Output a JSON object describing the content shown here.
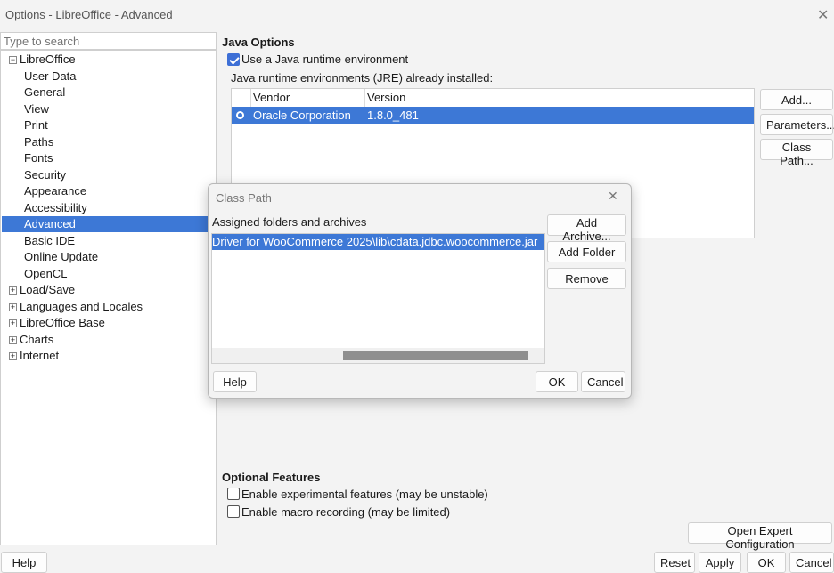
{
  "window": {
    "title": "Options - LibreOffice - Advanced"
  },
  "search": {
    "placeholder": "Type to search"
  },
  "tree": {
    "root_libreoffice": "LibreOffice",
    "libreoffice_children": [
      "User Data",
      "General",
      "View",
      "Print",
      "Paths",
      "Fonts",
      "Security",
      "Appearance",
      "Accessibility",
      "Advanced",
      "Basic IDE",
      "Online Update",
      "OpenCL"
    ],
    "selected": "Advanced",
    "roots": [
      "Load/Save",
      "Languages and Locales",
      "LibreOffice Base",
      "Charts",
      "Internet"
    ]
  },
  "java": {
    "section_title": "Java Options",
    "use_jre_label": "Use a Java runtime environment",
    "use_jre_checked": true,
    "installed_label": "Java runtime environments (JRE) already installed:",
    "columns": [
      "Vendor",
      "Version"
    ],
    "rows": [
      {
        "vendor": "Oracle Corporation",
        "version": "1.8.0_481"
      }
    ],
    "add_button": "Add...",
    "parameters_button": "Parameters...",
    "classpath_button": "Class Path..."
  },
  "optional": {
    "section_title": "Optional Features",
    "experimental_label": "Enable experimental features (may be unstable)",
    "macro_label": "Enable macro recording (may be limited)",
    "experimental_checked": false,
    "macro_checked": false
  },
  "expert_button": "Open Expert Configuration",
  "bottom": {
    "help": "Help",
    "reset": "Reset",
    "apply": "Apply",
    "ok": "OK",
    "cancel": "Cancel"
  },
  "dialog": {
    "title": "Class Path",
    "list_label": "Assigned folders and archives",
    "entries": [
      "Driver for WooCommerce 2025\\lib\\cdata.jdbc.woocommerce.jar"
    ],
    "add_archive": "Add Archive...",
    "add_folder": "Add Folder",
    "remove": "Remove",
    "help": "Help",
    "ok": "OK",
    "cancel": "Cancel"
  },
  "colors": {
    "selection": "#3d78d6",
    "background": "#f3f3f3"
  }
}
